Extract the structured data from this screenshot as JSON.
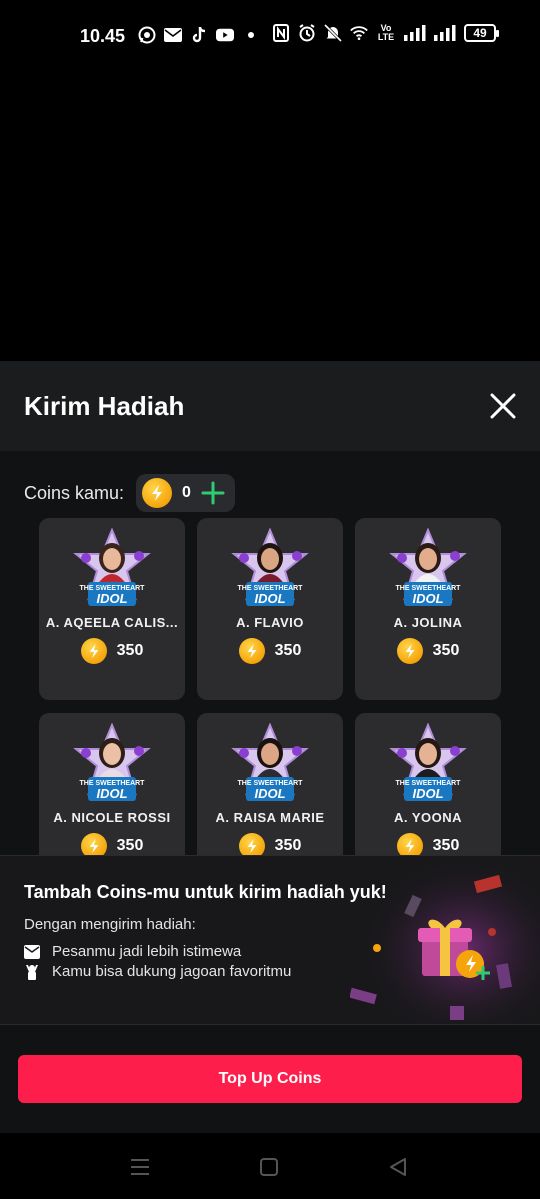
{
  "status_bar": {
    "time": "10.45",
    "battery": "49",
    "icons": [
      "whatsapp-icon",
      "mail-icon",
      "tiktok-icon",
      "youtube-icon",
      "dot-icon",
      "nfc-icon",
      "alarm-icon",
      "mute-icon",
      "wifi-icon",
      "volte-icon",
      "signal-icon",
      "signal-icon",
      "battery-icon"
    ],
    "volte_label": "Vo\nLTE"
  },
  "sheet": {
    "title": "Kirim Hadiah",
    "coins_label": "Coins kamu:",
    "coins_value": "0"
  },
  "gifts": [
    {
      "name": "A. AQEELA CALIS...",
      "price": "350",
      "art_text": "THE SWEETHEART IDOL"
    },
    {
      "name": "A. FLAVIO",
      "price": "350",
      "art_text": "THE SWEETHEART IDOL"
    },
    {
      "name": "A. JOLINA",
      "price": "350",
      "art_text": "THE SWEETHEART IDOL"
    },
    {
      "name": "A. NICOLE ROSSI",
      "price": "350",
      "art_text": "THE SWEETHEART IDOL"
    },
    {
      "name": "A. RAISA MARIE",
      "price": "350",
      "art_text": "THE SWEETHEART IDOL"
    },
    {
      "name": "A. YOONA",
      "price": "350",
      "art_text": "THE SWEETHEART IDOL"
    }
  ],
  "promo": {
    "title": "Tambah Coins-mu untuk kirim hadiah yuk!",
    "subtitle": "Dengan mengirim hadiah:",
    "items": [
      {
        "icon": "mail-icon",
        "text": "Pesanmu jadi lebih istimewa"
      },
      {
        "icon": "cheer-icon",
        "text": "Kamu bisa dukung jagoan favoritmu"
      }
    ]
  },
  "topup": {
    "label": "Top Up Coins"
  },
  "colors": {
    "accent": "#fe1e4c",
    "coin": "#f5a50b",
    "plus": "#2ecc71",
    "card_bg": "#2c2c2e",
    "sheet_bg": "#111214"
  }
}
